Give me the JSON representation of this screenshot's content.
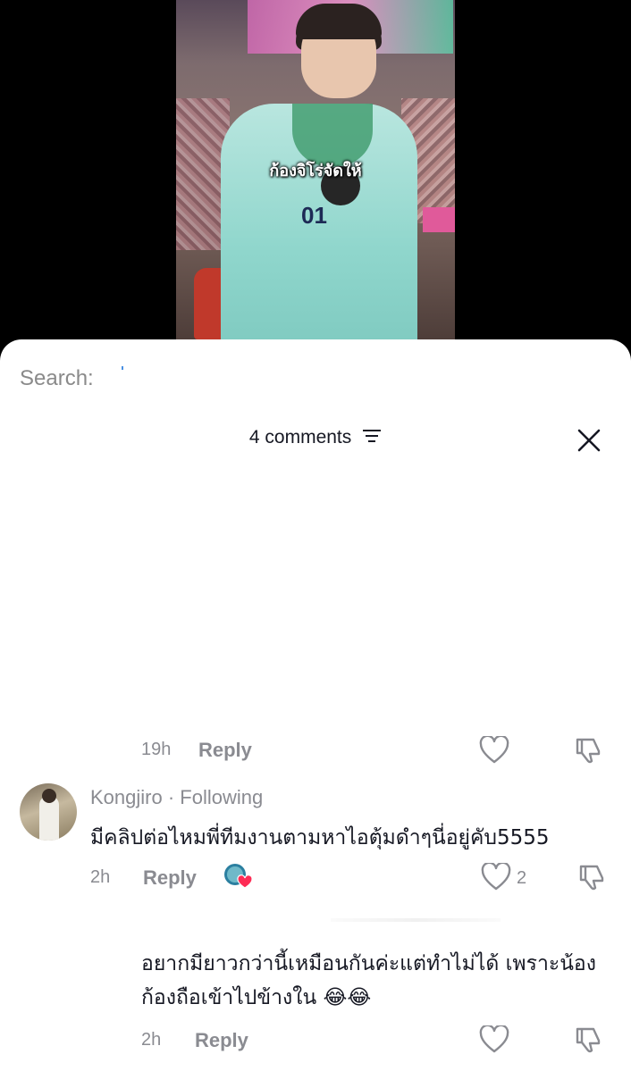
{
  "video": {
    "caption": "ก้องจิโร่จัดให้",
    "jersey_number": "01"
  },
  "search": {
    "label": "Search:"
  },
  "comments_header": {
    "count_text": "4 comments",
    "filter_icon": "filter-icon",
    "close_icon": "close-icon"
  },
  "comments": [
    {
      "time": "19h",
      "reply_label": "Reply"
    },
    {
      "username": "Kongjiro · Following",
      "text": "มีคลิปต่อไหมพี่ทีมงานตามหาไอตุ้มดำๆนี่อยู่คับ5555",
      "time": "2h",
      "reply_label": "Reply",
      "likes": "2",
      "creator_liked": true
    },
    {
      "text": "อยากมียาวกว่านี้เหมือนกันค่ะแต่ทำไม่ได้ เพราะน้องก้องถือเข้าไปข้างใน 😂😂",
      "time": "2h",
      "reply_label": "Reply"
    }
  ],
  "colors": {
    "primary_text": "#161823",
    "secondary_text": "#8a8b91",
    "liked_heart": "#fe2c55"
  }
}
